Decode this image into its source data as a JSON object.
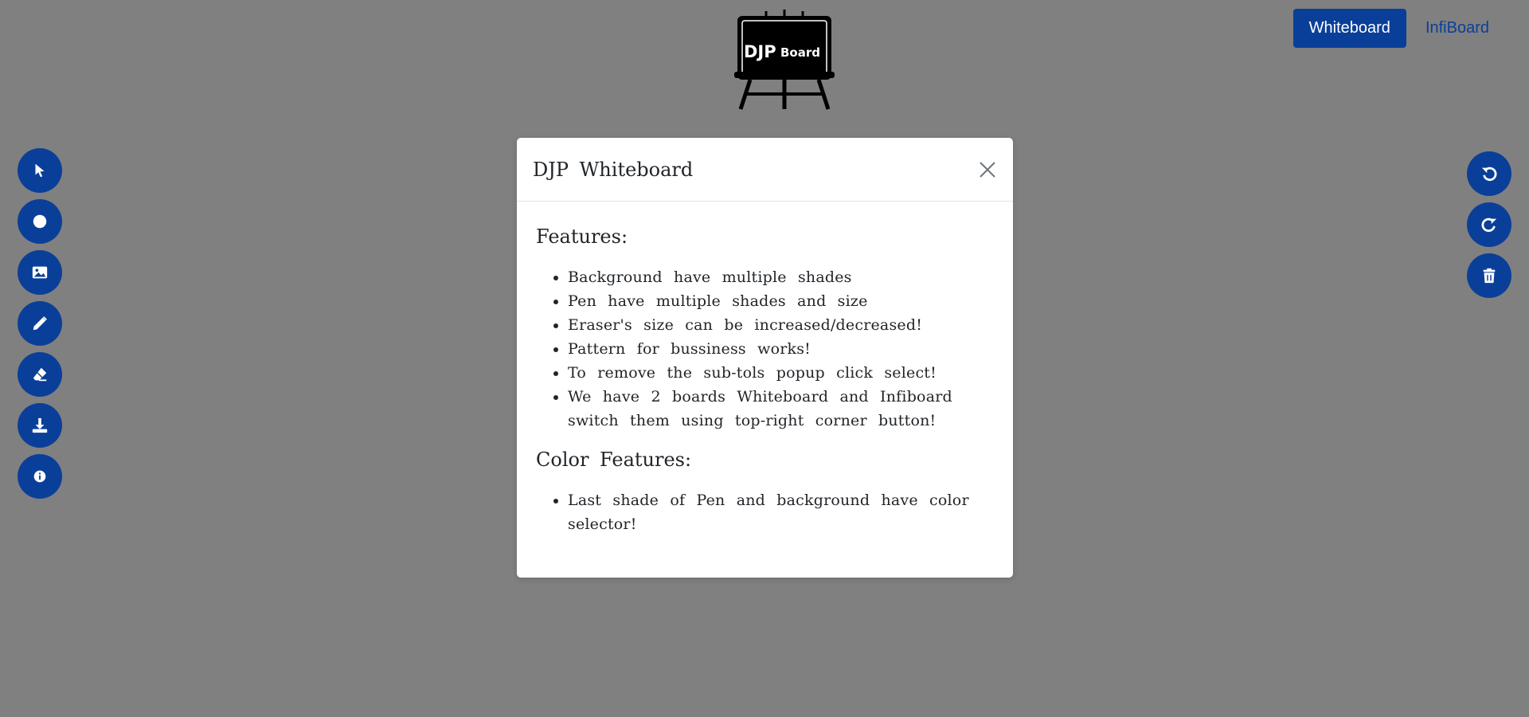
{
  "logo": {
    "text_main": "DJP",
    "text_sub": "Board"
  },
  "nav": {
    "whiteboard_label": "Whiteboard",
    "infiboard_label": "InfiBoard"
  },
  "left_tools": [
    {
      "name": "select-tool",
      "icon": "pointer-icon"
    },
    {
      "name": "shape-tool",
      "icon": "circle-icon"
    },
    {
      "name": "image-tool",
      "icon": "image-icon"
    },
    {
      "name": "pen-tool",
      "icon": "pencil-icon"
    },
    {
      "name": "eraser-tool",
      "icon": "eraser-icon"
    },
    {
      "name": "download-tool",
      "icon": "download-icon"
    },
    {
      "name": "info-tool",
      "icon": "info-icon"
    }
  ],
  "right_tools": [
    {
      "name": "undo-button",
      "icon": "undo-icon"
    },
    {
      "name": "redo-button",
      "icon": "redo-icon"
    },
    {
      "name": "clear-button",
      "icon": "trash-icon"
    }
  ],
  "modal": {
    "title": "DJP Whiteboard",
    "features_heading": "Features:",
    "features": [
      "Background have multiple shades",
      "Pen have multiple shades and size",
      "Eraser's size can be increased/decreased!",
      "Pattern for bussiness works!",
      "To remove the sub-tols popup click select!",
      "We have 2 boards Whiteboard and Infiboard switch them using top-right corner button!"
    ],
    "color_heading": "Color Features:",
    "color_features": [
      "Last shade of Pen and background have color selector!"
    ]
  },
  "colors": {
    "backdrop": "#808080",
    "accent": "#0a3f99"
  }
}
